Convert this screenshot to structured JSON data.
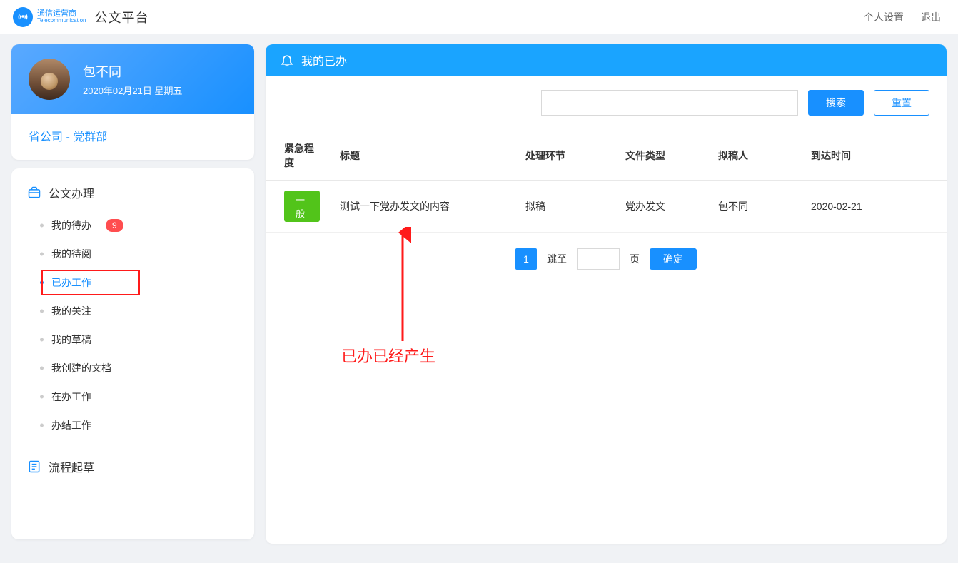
{
  "header": {
    "brand_cn": "通信运营商",
    "brand_en": "Telecommunication",
    "app_title": "公文平台",
    "links": {
      "settings": "个人设置",
      "logout": "退出"
    }
  },
  "user": {
    "name": "包不同",
    "date_line": "2020年02月21日 星期五",
    "dept": "省公司 - 党群部"
  },
  "nav": {
    "section1_title": "公文办理",
    "items": [
      {
        "label": "我的待办",
        "badge": "9",
        "active": false
      },
      {
        "label": "我的待阅",
        "active": false
      },
      {
        "label": "已办工作",
        "active": true,
        "highlighted": true
      },
      {
        "label": "我的关注",
        "active": false
      },
      {
        "label": "我的草稿",
        "active": false
      },
      {
        "label": "我创建的文档",
        "active": false
      },
      {
        "label": "在办工作",
        "active": false
      },
      {
        "label": "办结工作",
        "active": false
      }
    ],
    "section2_title": "流程起草"
  },
  "main": {
    "title": "我的已办",
    "toolbar": {
      "search_placeholder": "",
      "search_btn": "搜索",
      "reset_btn": "重置"
    },
    "table": {
      "headers": {
        "urgency": "紧急程度",
        "title": "标题",
        "step": "处理环节",
        "filetype": "文件类型",
        "drafter": "拟稿人",
        "arrive": "到达时间"
      },
      "rows": [
        {
          "urgency": "一般",
          "title": "测试一下党办发文的内容",
          "step": "拟稿",
          "filetype": "党办发文",
          "drafter": "包不同",
          "arrive": "2020-02-21"
        }
      ]
    },
    "pager": {
      "current": "1",
      "jump_label": "跳至",
      "page_unit": "页",
      "confirm": "确定"
    },
    "annotation": "已办已经产生"
  }
}
